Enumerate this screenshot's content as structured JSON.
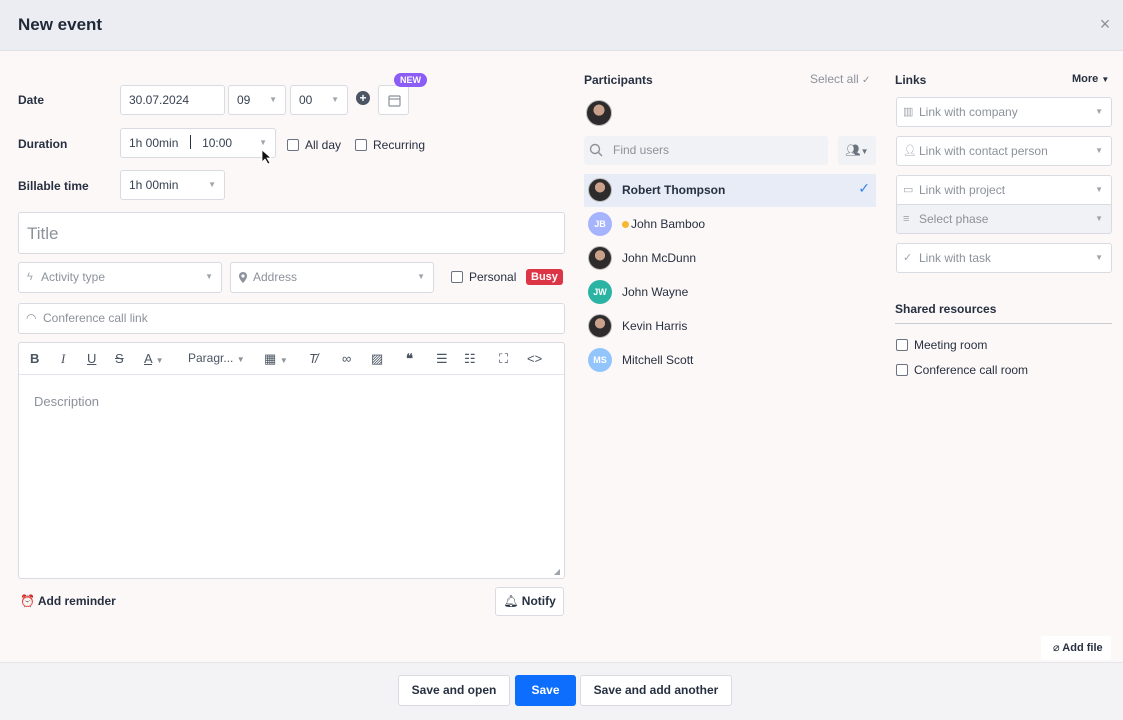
{
  "header": {
    "title": "New event",
    "close": "×"
  },
  "form": {
    "date_label": "Date",
    "date_value": "30.07.2024",
    "hour_value": "09",
    "minute_value": "00",
    "new_badge": "NEW",
    "duration_label": "Duration",
    "duration_value": "1h 00min",
    "duration_end": "10:00",
    "all_day": "All day",
    "recurring": "Recurring",
    "billable_label": "Billable time",
    "billable_value": "1h 00min",
    "title_placeholder": "Title",
    "activity_type": "Activity type",
    "address": "Address",
    "personal": "Personal",
    "busy": "Busy",
    "conference": "Conference call link",
    "paragraph": "Paragr...",
    "description_placeholder": "Description",
    "add_reminder": "Add reminder",
    "notify": "Notify"
  },
  "participants": {
    "heading": "Participants",
    "select_all": "Select all",
    "find_placeholder": "Find users",
    "users": [
      {
        "name": "Robert Thompson",
        "initials": "",
        "color": "",
        "selected": true
      },
      {
        "name": "John Bamboo",
        "initials": "JB",
        "color": "#a5b4fc",
        "selected": false
      },
      {
        "name": "John McDunn",
        "initials": "",
        "color": "",
        "selected": false
      },
      {
        "name": "John Wayne",
        "initials": "JW",
        "color": "#2bb3a3",
        "selected": false
      },
      {
        "name": "Kevin Harris",
        "initials": "",
        "color": "",
        "selected": false
      },
      {
        "name": "Mitchell Scott",
        "initials": "MS",
        "color": "#93c5fd",
        "selected": false
      }
    ]
  },
  "links": {
    "heading": "Links",
    "more": "More",
    "company": "Link with company",
    "contact": "Link with contact person",
    "project": "Link with project",
    "phase": "Select phase",
    "task": "Link with task"
  },
  "resources": {
    "heading": "Shared resources",
    "meeting_room": "Meeting room",
    "conference_room": "Conference call room"
  },
  "footer": {
    "add_file": "Add file",
    "save_and_open": "Save and open",
    "save": "Save",
    "save_and_add": "Save and add another"
  },
  "colors": {
    "primary": "#0d6efd",
    "busy": "#dc3545",
    "new_badge": "#8b5cf6"
  }
}
